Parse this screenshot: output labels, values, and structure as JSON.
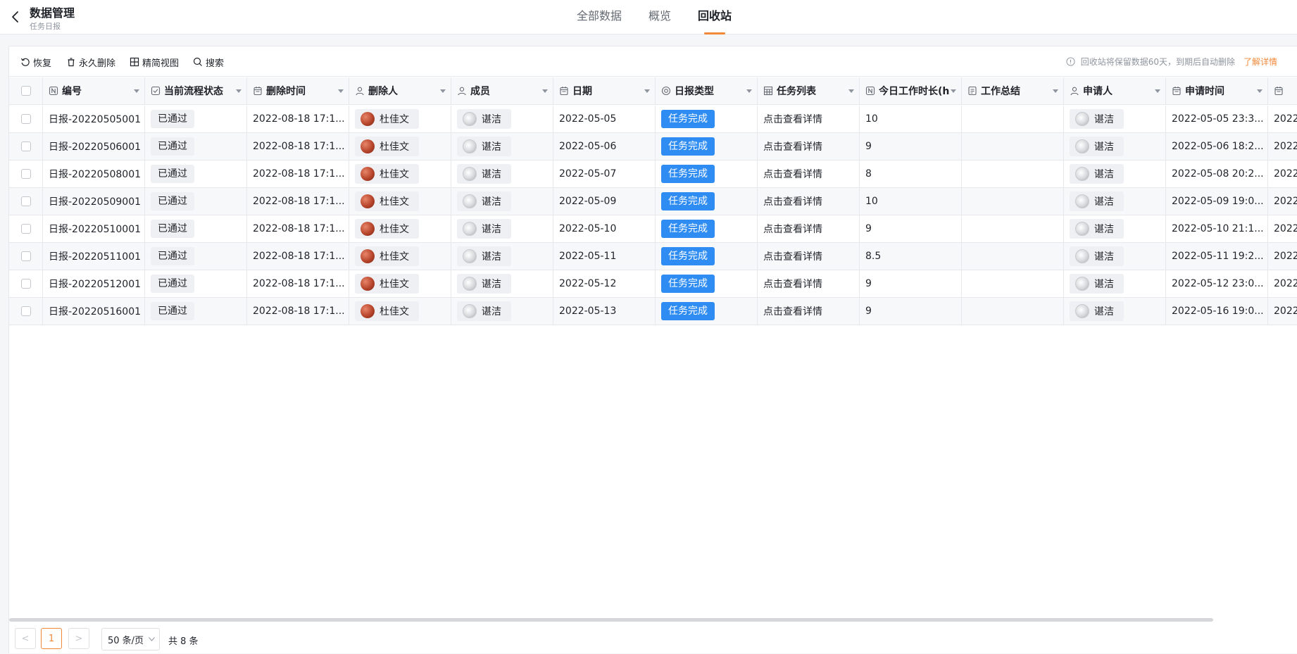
{
  "header": {
    "title": "数据管理",
    "subtitle": "任务日报",
    "tabs": [
      {
        "label": "全部数据",
        "active": false
      },
      {
        "label": "概览",
        "active": false
      },
      {
        "label": "回收站",
        "active": true
      }
    ]
  },
  "toolbar": {
    "restore_label": "恢复",
    "delete_label": "永久删除",
    "view_label": "精简视图",
    "search_label": "搜索",
    "notice": "回收站将保留数据60天，到期后自动删除",
    "notice_link": "了解详情"
  },
  "table": {
    "columns": [
      {
        "key": "id",
        "label": "编号",
        "icon": "number-field-icon"
      },
      {
        "key": "status",
        "label": "当前流程状态",
        "icon": "check-square-icon"
      },
      {
        "key": "deleted_at",
        "label": "删除时间",
        "icon": "calendar-icon"
      },
      {
        "key": "deleted_by",
        "label": "删除人",
        "icon": "user-icon"
      },
      {
        "key": "member",
        "label": "成员",
        "icon": "user-icon"
      },
      {
        "key": "date",
        "label": "日期",
        "icon": "calendar-icon"
      },
      {
        "key": "report_type",
        "label": "日报类型",
        "icon": "radio-target-icon"
      },
      {
        "key": "task_list",
        "label": "任务列表",
        "icon": "table-icon"
      },
      {
        "key": "hours",
        "label": "今日工作时长(h",
        "icon": "number-field-icon"
      },
      {
        "key": "summary",
        "label": "工作总结",
        "icon": "document-icon"
      },
      {
        "key": "applicant",
        "label": "申请人",
        "icon": "user-icon"
      },
      {
        "key": "applied_at",
        "label": "申请时间",
        "icon": "calendar-icon"
      },
      {
        "key": "extra",
        "label": "",
        "icon": "calendar-icon"
      }
    ],
    "rows": [
      {
        "id": "日报-20220505001",
        "status": "已通过",
        "deleted_at": "2022-08-18 17:1...",
        "deleted_by": "杜佳文",
        "member": "谌洁",
        "date": "2022-05-05",
        "report_type": "任务完成",
        "task_list": "点击查看详情",
        "hours": "10",
        "summary": "",
        "applicant": "谌洁",
        "applied_at": "2022-05-05 23:3...",
        "extra": "2022"
      },
      {
        "id": "日报-20220506001",
        "status": "已通过",
        "deleted_at": "2022-08-18 17:1...",
        "deleted_by": "杜佳文",
        "member": "谌洁",
        "date": "2022-05-06",
        "report_type": "任务完成",
        "task_list": "点击查看详情",
        "hours": "9",
        "summary": "",
        "applicant": "谌洁",
        "applied_at": "2022-05-06 18:2...",
        "extra": "2022"
      },
      {
        "id": "日报-20220508001",
        "status": "已通过",
        "deleted_at": "2022-08-18 17:1...",
        "deleted_by": "杜佳文",
        "member": "谌洁",
        "date": "2022-05-07",
        "report_type": "任务完成",
        "task_list": "点击查看详情",
        "hours": "8",
        "summary": "",
        "applicant": "谌洁",
        "applied_at": "2022-05-08 20:2...",
        "extra": "2022"
      },
      {
        "id": "日报-20220509001",
        "status": "已通过",
        "deleted_at": "2022-08-18 17:1...",
        "deleted_by": "杜佳文",
        "member": "谌洁",
        "date": "2022-05-09",
        "report_type": "任务完成",
        "task_list": "点击查看详情",
        "hours": "10",
        "summary": "",
        "applicant": "谌洁",
        "applied_at": "2022-05-09 19:0...",
        "extra": "2022"
      },
      {
        "id": "日报-20220510001",
        "status": "已通过",
        "deleted_at": "2022-08-18 17:1...",
        "deleted_by": "杜佳文",
        "member": "谌洁",
        "date": "2022-05-10",
        "report_type": "任务完成",
        "task_list": "点击查看详情",
        "hours": "9",
        "summary": "",
        "applicant": "谌洁",
        "applied_at": "2022-05-10 21:1...",
        "extra": "2022"
      },
      {
        "id": "日报-20220511001",
        "status": "已通过",
        "deleted_at": "2022-08-18 17:1...",
        "deleted_by": "杜佳文",
        "member": "谌洁",
        "date": "2022-05-11",
        "report_type": "任务完成",
        "task_list": "点击查看详情",
        "hours": "8.5",
        "summary": "",
        "applicant": "谌洁",
        "applied_at": "2022-05-11 19:2...",
        "extra": "2022"
      },
      {
        "id": "日报-20220512001",
        "status": "已通过",
        "deleted_at": "2022-08-18 17:1...",
        "deleted_by": "杜佳文",
        "member": "谌洁",
        "date": "2022-05-12",
        "report_type": "任务完成",
        "task_list": "点击查看详情",
        "hours": "9",
        "summary": "",
        "applicant": "谌洁",
        "applied_at": "2022-05-12 23:0...",
        "extra": "2022"
      },
      {
        "id": "日报-20220516001",
        "status": "已通过",
        "deleted_at": "2022-08-18 17:1...",
        "deleted_by": "杜佳文",
        "member": "谌洁",
        "date": "2022-05-13",
        "report_type": "任务完成",
        "task_list": "点击查看详情",
        "hours": "9",
        "summary": "",
        "applicant": "谌洁",
        "applied_at": "2022-05-16 19:0...",
        "extra": "2022"
      }
    ]
  },
  "pagination": {
    "prev": "<",
    "next": ">",
    "current_page": "1",
    "page_size": "50 条/页",
    "total": "共 8 条"
  },
  "colors": {
    "accent": "#f0893a",
    "tag_blue": "#2f8cf2"
  }
}
